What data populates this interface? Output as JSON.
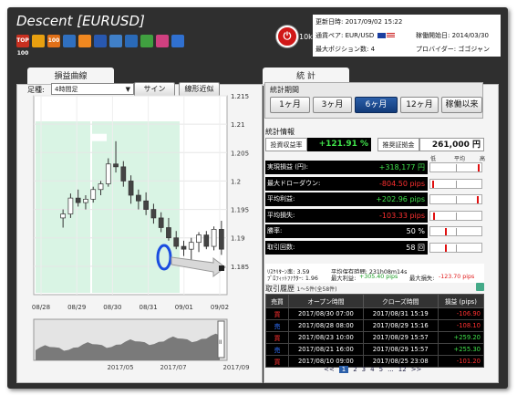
{
  "window_title": "Descent [EURUSD]",
  "toolbar_icons": [
    {
      "icon": "top-100-badge-icon",
      "label": "TOP 100",
      "color": "#c83020"
    },
    {
      "icon": "yellow-badge-icon",
      "label": "",
      "color": "#e8a010"
    },
    {
      "icon": "orange-badge-icon",
      "label": "100",
      "color": "#e07018"
    },
    {
      "icon": "trophy-badge-icon",
      "label": "",
      "color": "#3070c0"
    },
    {
      "icon": "orange-square-icon",
      "label": "",
      "color": "#f08820"
    },
    {
      "icon": "blue-square-icon",
      "label": "",
      "color": "#2858b0"
    },
    {
      "icon": "crossed-tools-icon",
      "label": "",
      "color": "#4080c8"
    },
    {
      "icon": "flower-badge-icon",
      "label": "",
      "color": "#2a6ab8"
    },
    {
      "icon": "green-arrow-icon",
      "label": "",
      "color": "#40a040"
    },
    {
      "icon": "pink-badge-icon",
      "label": "",
      "color": "#d04080"
    },
    {
      "icon": "blue-circle-icon",
      "label": "",
      "color": "#3070d0"
    }
  ],
  "power": {
    "label": "10k"
  },
  "info": {
    "updated_label": "更新日時:",
    "updated_value": "2017/09/02 15:22",
    "pair_label": "通貨ペア:",
    "pair_value": "EUR/USD",
    "max_pos_label": "最大ポジション数:",
    "max_pos_value": "4",
    "start_label": "稼働開始日:",
    "start_value": "2014/03/30",
    "provider_label": "プロバイダー:",
    "provider_value": "ゴゴジャン"
  },
  "tabs": {
    "left": "損益曲線",
    "right": "統 計"
  },
  "chart_controls": {
    "timeframe_label": "足種:",
    "timeframe_value": "4時間足",
    "sign_button": "サイン",
    "linear_button": "線形近似"
  },
  "chart_data": {
    "type": "candlestick",
    "x_ticks": [
      "08/28",
      "08/29",
      "08/30",
      "08/31",
      "09/01",
      "09/02"
    ],
    "y_ticks": [
      "1.215",
      "1.21",
      "1.205",
      "1.2",
      "1.195",
      "1.19",
      "1.185"
    ],
    "ylim": [
      1.18,
      1.215
    ],
    "candles": [
      {
        "o": 1.1935,
        "h": 1.195,
        "l": 1.1918,
        "c": 1.1942
      },
      {
        "o": 1.1942,
        "h": 1.1978,
        "l": 1.1935,
        "c": 1.197
      },
      {
        "o": 1.197,
        "h": 1.1985,
        "l": 1.1955,
        "c": 1.1962
      },
      {
        "o": 1.1962,
        "h": 1.1975,
        "l": 1.195,
        "c": 1.1968
      },
      {
        "o": 1.1968,
        "h": 1.199,
        "l": 1.1962,
        "c": 1.1985
      },
      {
        "o": 1.1985,
        "h": 1.2,
        "l": 1.1975,
        "c": 1.1995
      },
      {
        "o": 1.1995,
        "h": 1.204,
        "l": 1.199,
        "c": 1.203
      },
      {
        "o": 1.203,
        "h": 1.207,
        "l": 1.2015,
        "c": 1.2025
      },
      {
        "o": 1.2025,
        "h": 1.2035,
        "l": 1.199,
        "c": 1.2
      },
      {
        "o": 1.2,
        "h": 1.201,
        "l": 1.196,
        "c": 1.1975
      },
      {
        "o": 1.1975,
        "h": 1.1985,
        "l": 1.195,
        "c": 1.1965
      },
      {
        "o": 1.1965,
        "h": 1.198,
        "l": 1.194,
        "c": 1.195
      },
      {
        "o": 1.195,
        "h": 1.196,
        "l": 1.1925,
        "c": 1.1935
      },
      {
        "o": 1.1935,
        "h": 1.1945,
        "l": 1.191,
        "c": 1.1918
      },
      {
        "o": 1.1918,
        "h": 1.1935,
        "l": 1.1895,
        "c": 1.19
      },
      {
        "o": 1.19,
        "h": 1.1912,
        "l": 1.188,
        "c": 1.1885
      },
      {
        "o": 1.1885,
        "h": 1.1895,
        "l": 1.1868,
        "c": 1.188
      },
      {
        "o": 1.188,
        "h": 1.19,
        "l": 1.186,
        "c": 1.1892
      },
      {
        "o": 1.1892,
        "h": 1.191,
        "l": 1.1875,
        "c": 1.1905
      },
      {
        "o": 1.1905,
        "h": 1.1912,
        "l": 1.188,
        "c": 1.1885
      },
      {
        "o": 1.1885,
        "h": 1.192,
        "l": 1.1878,
        "c": 1.1915
      },
      {
        "o": 1.1915,
        "h": 1.193,
        "l": 1.187,
        "c": 1.188
      }
    ],
    "shaded_periods_color": "#d9f4e4",
    "overview": {
      "labels": [
        "2017/05",
        "2017/07",
        "2017/09"
      ]
    }
  },
  "stats_period": {
    "label": "統計期間",
    "buttons": [
      "1ヶ月",
      "3ヶ月",
      "6ヶ月",
      "12ヶ月",
      "稼働以来"
    ],
    "active_index": 2
  },
  "stats_title": "統計情報",
  "summary": {
    "return_label": "投資収益率",
    "return_value": "+121.91 %",
    "margin_label": "推奨証拠金",
    "margin_value": "261,000 円",
    "bar_headers": [
      "低",
      "平均",
      "高"
    ]
  },
  "stats_rows": [
    {
      "label": "実現損益 (円):",
      "value": "+318,177 円",
      "color": "#3fe04a",
      "mark": 0.97
    },
    {
      "label": "最大ドローダウン:",
      "value": "-804.50 pips",
      "color": "#ff3030",
      "mark": 0.03
    },
    {
      "label": "平均利益:",
      "value": "+202.96 pips",
      "color": "#3fe04a",
      "mark": 0.95
    },
    {
      "label": "平均損失:",
      "value": "-103.33 pips",
      "color": "#ff3030",
      "mark": 0.06
    },
    {
      "label": "勝率:",
      "value": "50 %",
      "color": "#ffffff",
      "mark": 0.3
    },
    {
      "label": "取引回数:",
      "value": "58 回",
      "color": "#ffffff",
      "mark": 0.3
    }
  ],
  "extra_stats": {
    "risk_return": "ﾘｽｸﾘﾀｰﾝ率: 3.59",
    "avg_hold": "平均保有時間: 231h08m14s",
    "profit_factor": "ﾌﾟﾛﾌｨｯﾄﾌｧｸﾀｰ: 1.96",
    "max_profit_label": "最大利益:",
    "max_profit_value": "+305.40 pips",
    "max_loss_label": "最大損失:",
    "max_loss_value": "-123.70 pips"
  },
  "history": {
    "title": "取引履歴",
    "count_text": "1〜5件(全58件)",
    "headers": [
      "売買",
      "オープン時間",
      "クローズ時間",
      "損益 (pips)"
    ],
    "rows": [
      {
        "side": "買",
        "side_color": "#ff3030",
        "open": "2017/08/30 07:00",
        "close": "2017/08/31 15:19",
        "pips": "-106.90",
        "cls": "neg"
      },
      {
        "side": "売",
        "side_color": "#3070ff",
        "open": "2017/08/28 08:00",
        "close": "2017/08/29 15:16",
        "pips": "-108.10",
        "cls": "neg"
      },
      {
        "side": "買",
        "side_color": "#ff3030",
        "open": "2017/08/23 10:00",
        "close": "2017/08/29 15:57",
        "pips": "+259.20",
        "cls": "pos"
      },
      {
        "side": "売",
        "side_color": "#3070ff",
        "open": "2017/08/21 16:00",
        "close": "2017/08/29 15:57",
        "pips": "+255.30",
        "cls": "pos"
      },
      {
        "side": "買",
        "side_color": "#ff3030",
        "open": "2017/08/10 09:00",
        "close": "2017/08/25 23:08",
        "pips": "-101.20",
        "cls": "neg"
      }
    ]
  },
  "pager": {
    "prev": "<<",
    "pages": [
      "1",
      "2",
      "3",
      "4",
      "5",
      "...",
      "12"
    ],
    "next": ">>",
    "current": "1"
  }
}
